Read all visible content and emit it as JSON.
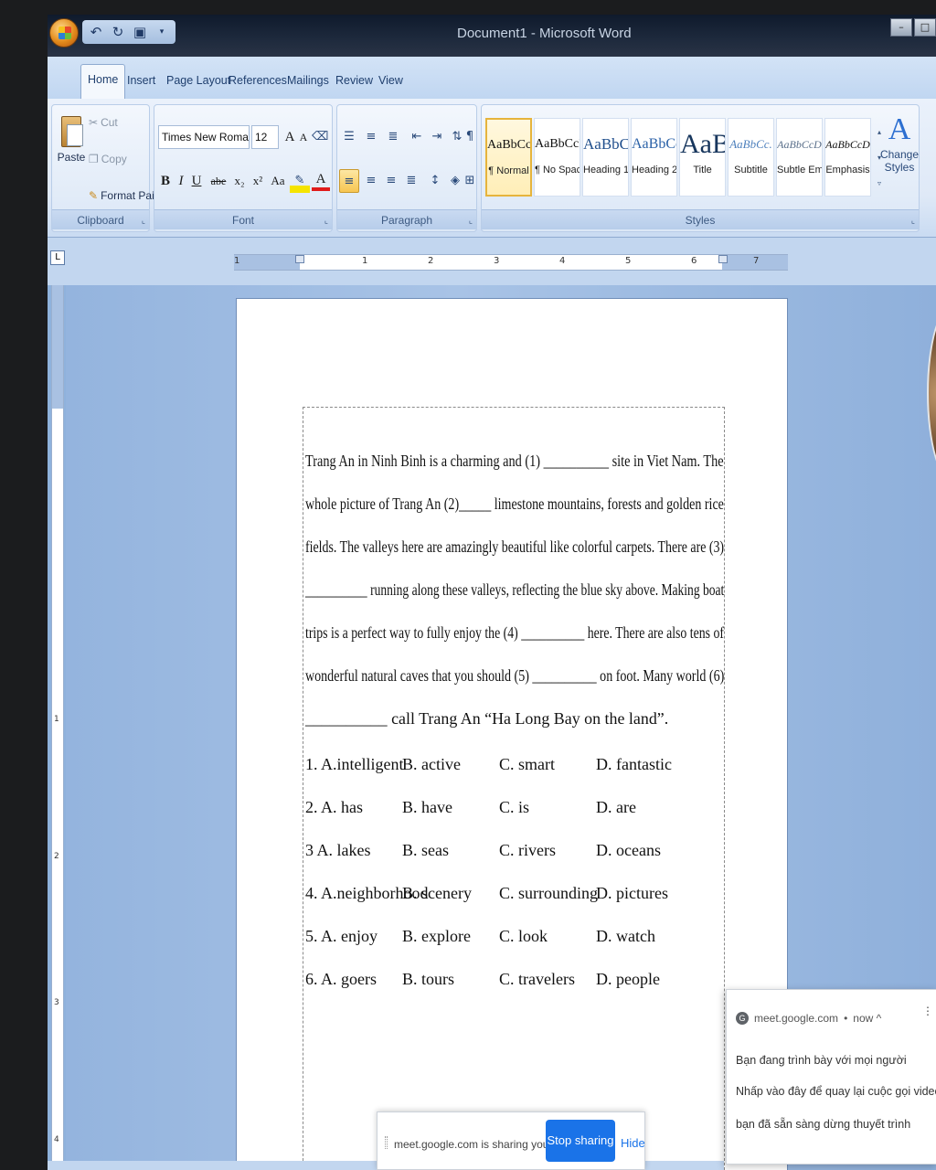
{
  "window": {
    "title": "Document1 - Microsoft Word",
    "controls": [
      "–",
      "□"
    ]
  },
  "quick_access": {
    "save_icon": "save-icon",
    "undo_icon": "undo-icon",
    "redo_icon": "redo-icon"
  },
  "tabs": [
    "Home",
    "Insert",
    "Page Layout",
    "References",
    "Mailings",
    "Review",
    "View"
  ],
  "ribbon": {
    "clipboard": {
      "label": "Clipboard",
      "paste": "Paste",
      "cut": "Cut",
      "copy": "Copy",
      "format_painter": "Format Painter"
    },
    "font": {
      "label": "Font",
      "font_name": "Times New Roman",
      "font_size": "12",
      "bold": "B",
      "italic": "I",
      "underline": "U",
      "strike": "abe",
      "subscript": "x₂",
      "superscript": "x²",
      "change_case": "Aa",
      "grow": "A",
      "shrink": "A"
    },
    "paragraph": {
      "label": "Paragraph"
    },
    "styles": {
      "label": "Styles",
      "items": [
        {
          "sample": "AaBbCcI",
          "name": "¶ Normal"
        },
        {
          "sample": "AaBbCcI",
          "name": "¶ No Spaci..."
        },
        {
          "sample": "AaBbC(",
          "name": "Heading 1"
        },
        {
          "sample": "AaBbCc",
          "name": "Heading 2"
        },
        {
          "sample": "AaB",
          "name": "Title"
        },
        {
          "sample": "AaBbCc.",
          "name": "Subtitle"
        },
        {
          "sample": "AaBbCcD",
          "name": "Subtle Em..."
        },
        {
          "sample": "AaBbCcD",
          "name": "Emphasis"
        }
      ],
      "change_styles": "Change Styles",
      "change_styles_icon": "A"
    }
  },
  "ruler": {
    "numbers": [
      "1",
      "1",
      "2",
      "3",
      "4",
      "5",
      "6",
      "7"
    ],
    "vertical_numbers": [
      "1",
      "2",
      "3",
      "4"
    ]
  },
  "document": {
    "lines": [
      "Trang An in Ninh Binh is a charming and (1) __________ site in Viet Nam. The",
      "whole picture of Trang An (2)_____ limestone mountains, forests and golden rice",
      "fields. The valleys here are amazingly beautiful like colorful carpets. There are (3)",
      "__________ running along these valleys, reflecting the blue sky above. Making boat",
      "trips is a perfect way to fully enjoy the (4) __________ here. There are also tens of",
      "wonderful natural caves that you should (5) __________ on foot. Many world (6)",
      "__________ call Trang An “Ha Long Bay on the land”."
    ],
    "options": [
      [
        "1. A.intelligent",
        "B. active",
        "C. smart",
        "D. fantastic"
      ],
      [
        "2. A. has",
        "B. have",
        "C. is",
        "D. are"
      ],
      [
        "3 A. lakes",
        "B. seas",
        "C. rivers",
        "D. oceans"
      ],
      [
        "4. A.neighborhood",
        "B. scenery",
        "C. surrounding",
        "D. pictures"
      ],
      [
        "5. A. enjoy",
        "B. explore",
        "C. look",
        "D. watch"
      ],
      [
        "6. A. goers",
        "B. tours",
        "C. travelers",
        "D. people"
      ]
    ]
  },
  "notification": {
    "source": "meet.google.com",
    "time": "now ^",
    "line1": "Bạn đang trình bày với mọi người",
    "line2": "Nhấp vào đây để quay lại cuộc gọi video khi",
    "line3": "bạn đã sẵn sàng dừng thuyết trình"
  },
  "sharing_bar": {
    "text": "meet.google.com is sharing your screen.",
    "stop": "Stop sharing",
    "hide": "Hide"
  }
}
